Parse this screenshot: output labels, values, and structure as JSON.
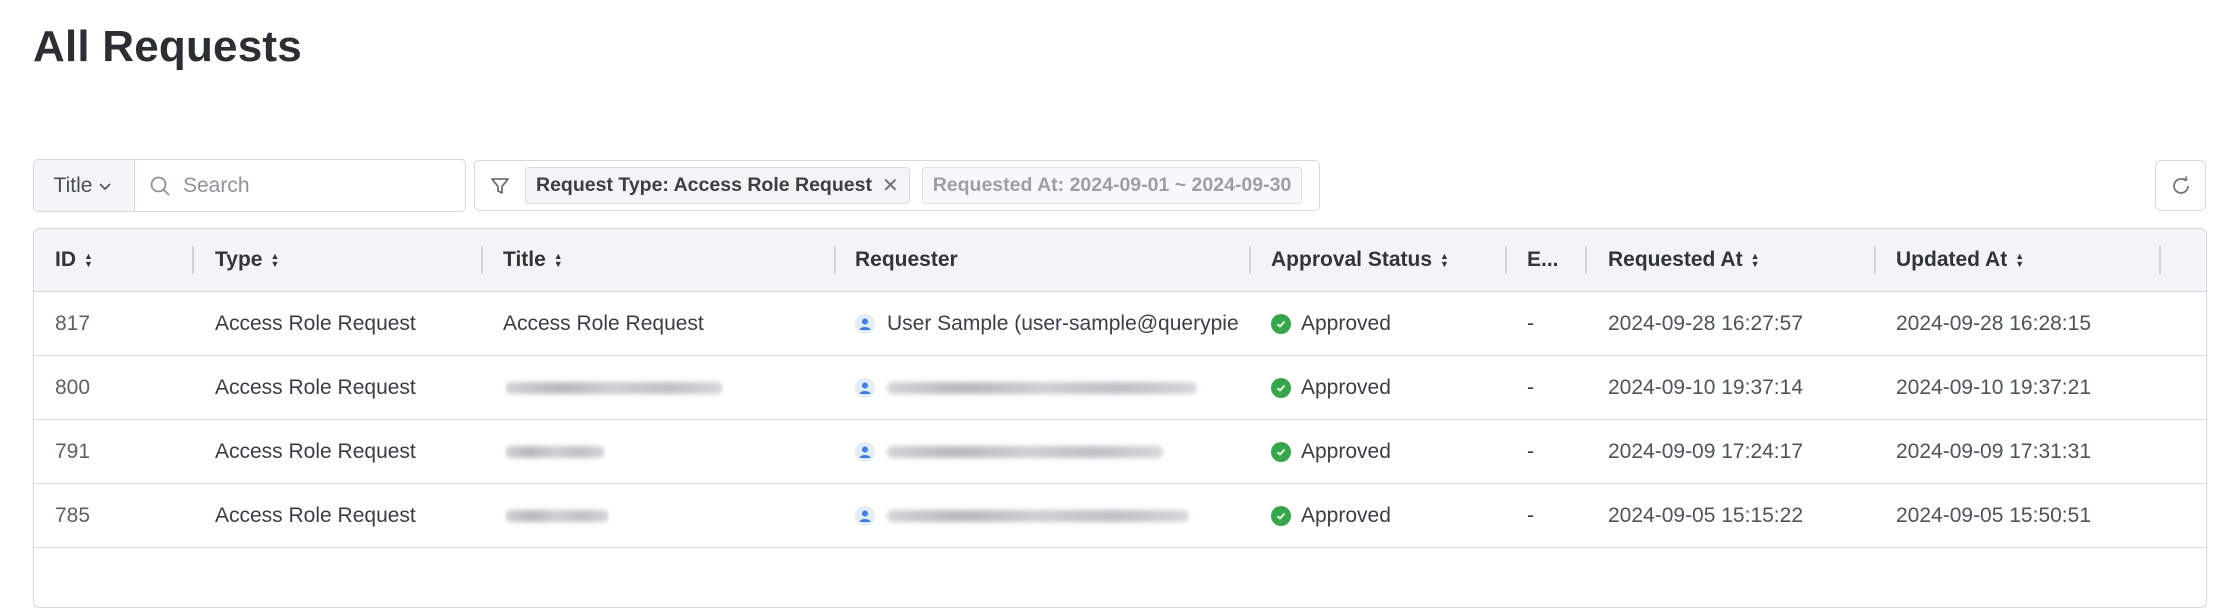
{
  "page": {
    "title": "All Requests"
  },
  "toolbar": {
    "field_select": "Title",
    "search_placeholder": "Search",
    "filters": [
      {
        "label": "Request Type: Access Role Request",
        "active": true
      },
      {
        "label": "Requested At: 2024-09-01 ~ 2024-09-30",
        "active": false
      }
    ]
  },
  "table": {
    "columns": [
      "ID",
      "Type",
      "Title",
      "Requester",
      "Approval Status",
      "E...",
      "Requested At",
      "Updated At"
    ],
    "rows": [
      {
        "id": "817",
        "type": "Access Role Request",
        "title": "Access Role Request",
        "requester": "User Sample (user-sample@querypie",
        "status": "Approved",
        "e": "-",
        "requested_at": "2024-09-28 16:27:57",
        "updated_at": "2024-09-28 16:28:15"
      },
      {
        "id": "800",
        "type": "Access Role Request",
        "title": "",
        "requester": "",
        "status": "Approved",
        "e": "-",
        "requested_at": "2024-09-10 19:37:14",
        "updated_at": "2024-09-10 19:37:21"
      },
      {
        "id": "791",
        "type": "Access Role Request",
        "title": "",
        "requester": "",
        "status": "Approved",
        "e": "-",
        "requested_at": "2024-09-09 17:24:17",
        "updated_at": "2024-09-09 17:31:31"
      },
      {
        "id": "785",
        "type": "Access Role Request",
        "title": "",
        "requester": "",
        "status": "Approved",
        "e": "-",
        "requested_at": "2024-09-05 15:15:22",
        "updated_at": "2024-09-05 15:50:51"
      }
    ]
  },
  "colors": {
    "status_approved": "#35a64a",
    "avatar": "#3b7de0",
    "border": "#d5d9de",
    "header_bg": "#f3f4f6"
  },
  "icons": [
    "search-icon",
    "filter-icon",
    "close-icon",
    "refresh-icon",
    "chevron-down-icon",
    "sort-icon",
    "user-icon",
    "check-circle-icon"
  ]
}
